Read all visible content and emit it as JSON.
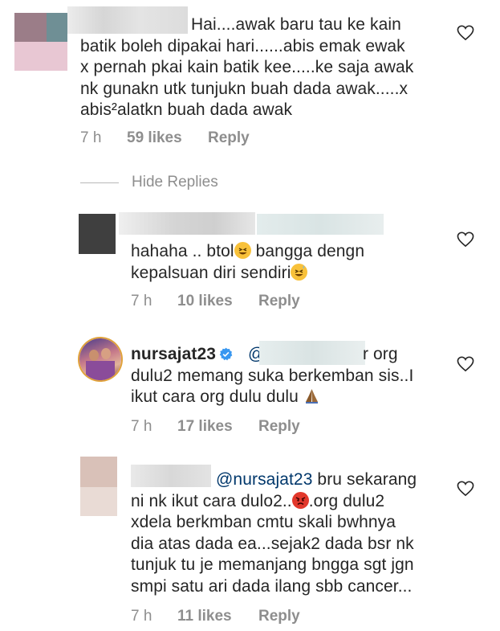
{
  "comments": [
    {
      "id": "c1",
      "lines": [
        "Hai....awak baru tau ke kain",
        "batik boleh dipakai hari......abis emak ewak",
        "x pernah pkai kain batik kee.....ke saja awak",
        "nk gunakn utk tunjukn buah dada awak.....x",
        "abis²alatkn buah dada awak"
      ],
      "time": "7 h",
      "likes": "59 likes",
      "reply": "Reply"
    },
    {
      "id": "c2",
      "line1_pre": "hahaha .. btol",
      "line1_post": " bangga dengn",
      "line2_pre": "kepalsuan diri sendiri",
      "time": "7 h",
      "likes": "10 likes",
      "reply": "Reply"
    },
    {
      "id": "c3",
      "username": "nursajat23",
      "mention_prefix": "@",
      "line1_tail": "r org",
      "lines": [
        "dulu2 memang suka berkemban sis..I",
        "ikut cara org dulu dulu"
      ],
      "time": "7 h",
      "likes": "17 likes",
      "reply": "Reply"
    },
    {
      "id": "c4",
      "mention": "@nursajat23",
      "line1_tail": " bru sekarang",
      "line2_pre": "ni nk ikut cara dulo2..",
      "line2_post": ".org dulu2",
      "lines": [
        "xdela berkmban cmtu skali bwhnya",
        "dia atas dada ea...sejak2 dada bsr nk",
        "tunjuk tu je memanjang bngga sgt jgn",
        "smpi satu ari dada ilang sbb cancer..."
      ],
      "time": "7 h",
      "likes": "11 likes",
      "reply": "Reply"
    }
  ],
  "hide_replies": "Hide Replies",
  "colors": {
    "text": "#262626",
    "meta": "#8e8e8e",
    "mention": "#00376b",
    "verified": "#3897f0"
  },
  "icons": {
    "heart": "heart-outline-icon",
    "verified": "verified-badge-icon"
  }
}
